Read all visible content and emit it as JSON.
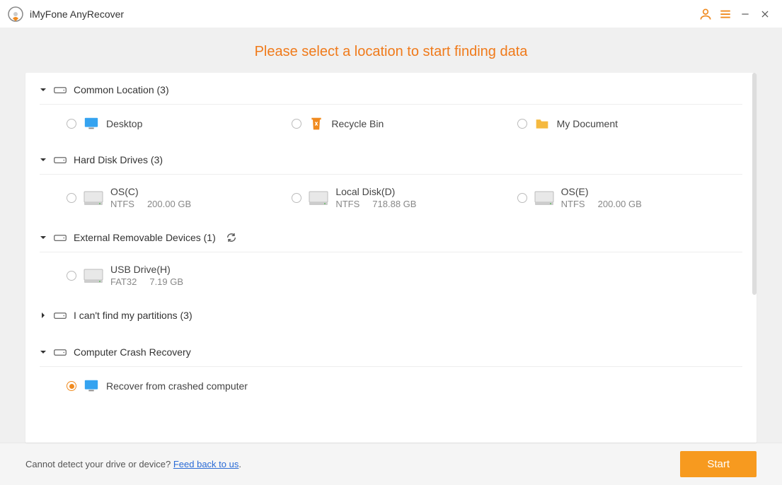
{
  "app": {
    "title": "iMyFone AnyRecover"
  },
  "heading": "Please select a location to start finding data",
  "sections": {
    "common": {
      "title": "Common Location (3)",
      "items": [
        {
          "label": "Desktop",
          "icon": "desktop"
        },
        {
          "label": "Recycle Bin",
          "icon": "recycle"
        },
        {
          "label": "My Document",
          "icon": "folder"
        }
      ]
    },
    "hdd": {
      "title": "Hard Disk Drives (3)",
      "items": [
        {
          "name": "OS(C)",
          "fs": "NTFS",
          "size": "200.00 GB"
        },
        {
          "name": "Local Disk(D)",
          "fs": "NTFS",
          "size": "718.88 GB"
        },
        {
          "name": "OS(E)",
          "fs": "NTFS",
          "size": "200.00 GB"
        }
      ]
    },
    "external": {
      "title": "External Removable Devices (1)",
      "items": [
        {
          "name": "USB Drive(H)",
          "fs": "FAT32",
          "size": "7.19 GB"
        }
      ]
    },
    "partitions": {
      "title": "I can't find my partitions (3)"
    },
    "crash": {
      "title": "Computer Crash Recovery",
      "items": [
        {
          "label": "Recover from crashed computer",
          "selected": true
        }
      ]
    }
  },
  "footer": {
    "text": "Cannot detect your drive or device? ",
    "link": "Feed back to us",
    "period": ".",
    "start": "Start"
  }
}
